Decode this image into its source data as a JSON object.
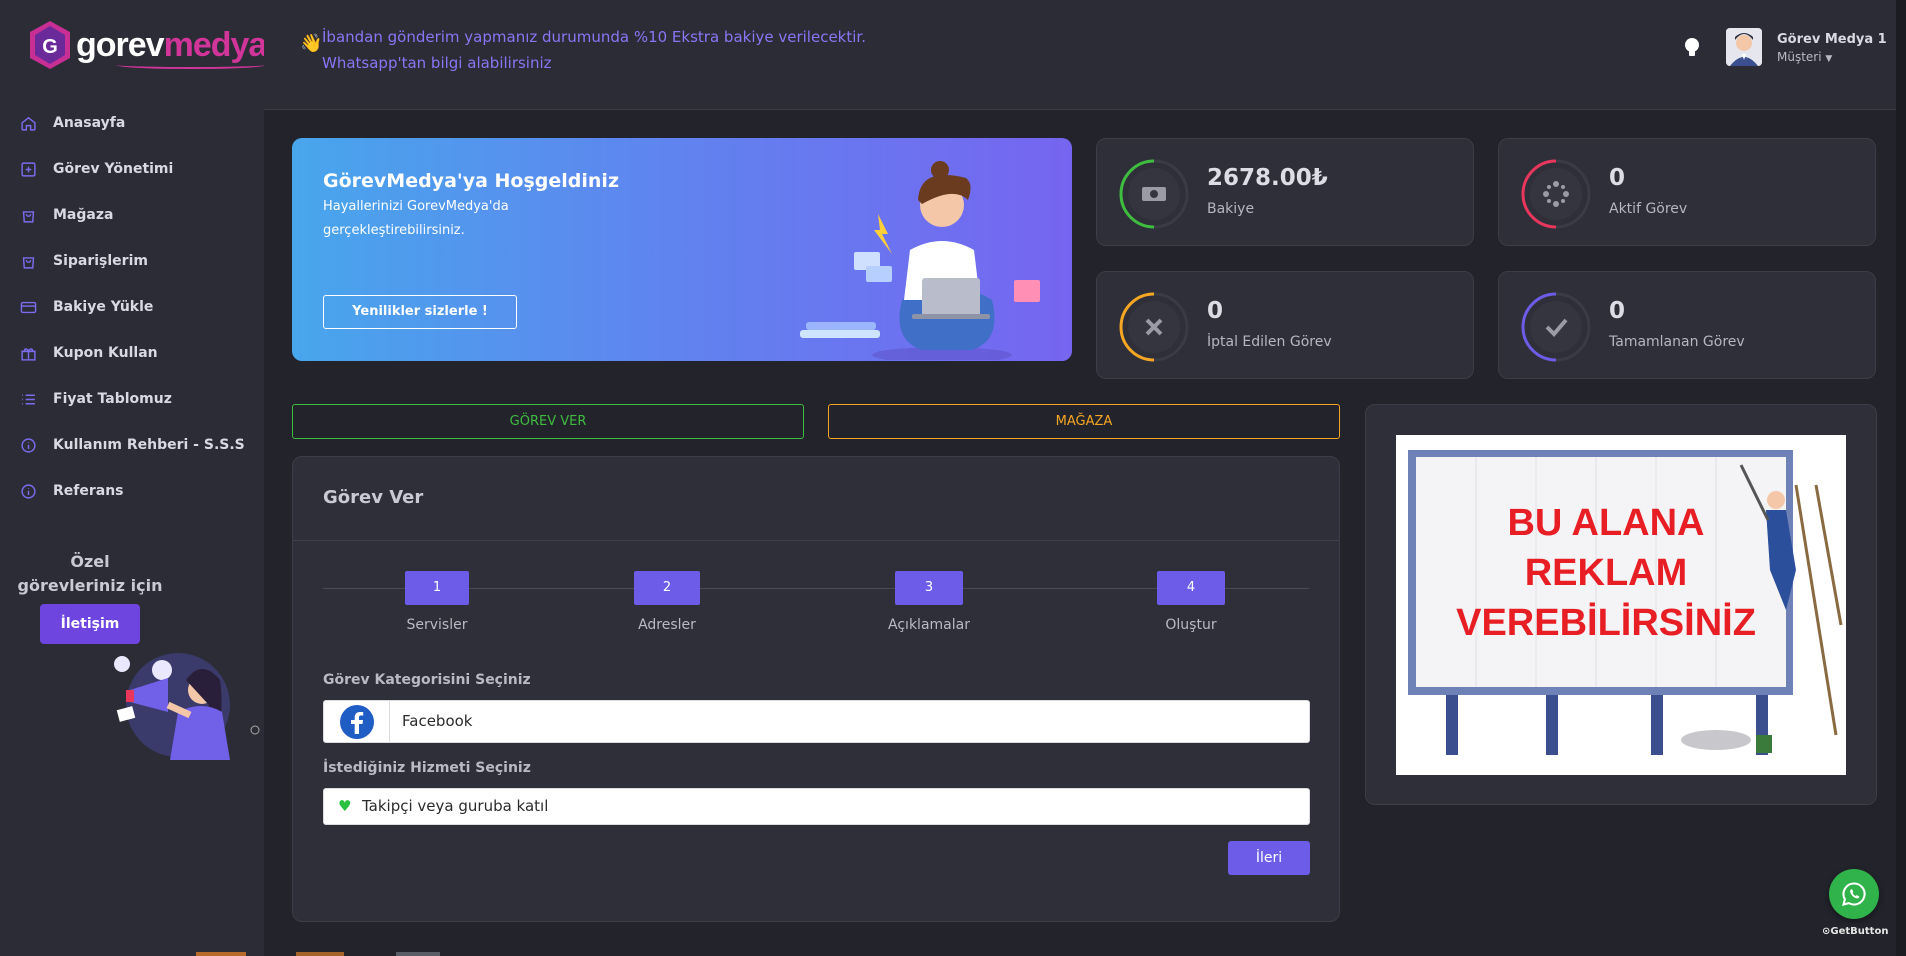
{
  "brand": {
    "part1": "gorev",
    "part2": "medya"
  },
  "sidebar": {
    "items": [
      {
        "label": "Anasayfa",
        "icon": "home-icon"
      },
      {
        "label": "Görev Yönetimi",
        "icon": "plus-square-icon"
      },
      {
        "label": "Mağaza",
        "icon": "shopping-bag-icon"
      },
      {
        "label": "Siparişlerim",
        "icon": "shopping-bag-icon"
      },
      {
        "label": "Bakiye Yükle",
        "icon": "credit-card-icon"
      },
      {
        "label": "Kupon Kullan",
        "icon": "gift-icon"
      },
      {
        "label": "Fiyat Tablomuz",
        "icon": "list-icon"
      },
      {
        "label": "Kullanım Rehberi - S.S.S",
        "icon": "info-icon"
      },
      {
        "label": "Referans",
        "icon": "info-icon"
      }
    ],
    "promo": {
      "line1": "Özel",
      "line2": "görevleriniz için",
      "button": "İletişim"
    }
  },
  "topbar": {
    "notice_line1": "İbandan gönderim yapmanız durumunda %10 Ekstra bakiye verilecektir.",
    "notice_line2": "Whatsapp'tan bilgi alabilirsiniz",
    "user_name": "Görev Medya 1",
    "user_role": "Müşteri"
  },
  "hero": {
    "title": "GörevMedya'ya Hoşgeldiniz",
    "subtitle": "Hayallerinizi GorevMedya'da gerçekleştirebilirsiniz.",
    "button": "Yenilikler sizlerle !"
  },
  "stats": [
    {
      "value": "2678.00₺",
      "label": "Bakiye",
      "color": "#3fbd3f",
      "icon": "money-icon"
    },
    {
      "value": "0",
      "label": "Aktif Görev",
      "color": "#e8365d",
      "icon": "spinner-icon"
    },
    {
      "value": "0",
      "label": "İptal Edilen Görev",
      "color": "#f5a623",
      "icon": "x-icon"
    },
    {
      "value": "0",
      "label": "Tamamlanan Görev",
      "color": "#6c5ce7",
      "icon": "check-icon"
    }
  ],
  "actions": {
    "task_button": "GÖREV VER",
    "store_button": "MAĞAZA"
  },
  "form": {
    "title": "Görev Ver",
    "steps": [
      {
        "num": "1",
        "label": "Servisler"
      },
      {
        "num": "2",
        "label": "Adresler"
      },
      {
        "num": "3",
        "label": "Açıklamalar"
      },
      {
        "num": "4",
        "label": "Oluştur"
      }
    ],
    "category_label": "Görev Kategorisini Seçiniz",
    "category_value": "Facebook",
    "service_label": "İstediğiniz Hizmeti Seçiniz",
    "service_value": "Takipçi veya guruba katıl",
    "next_button": "İleri"
  },
  "ad": {
    "line1": "BU ALANA",
    "line2": "REKLAM",
    "line3": "VEREBİLİRSİNİZ"
  },
  "whatsapp": {
    "label": "GetButton"
  },
  "colors": {
    "accent": "#6c5ce7",
    "green": "#3fbd3f",
    "orange": "#f5a623"
  }
}
